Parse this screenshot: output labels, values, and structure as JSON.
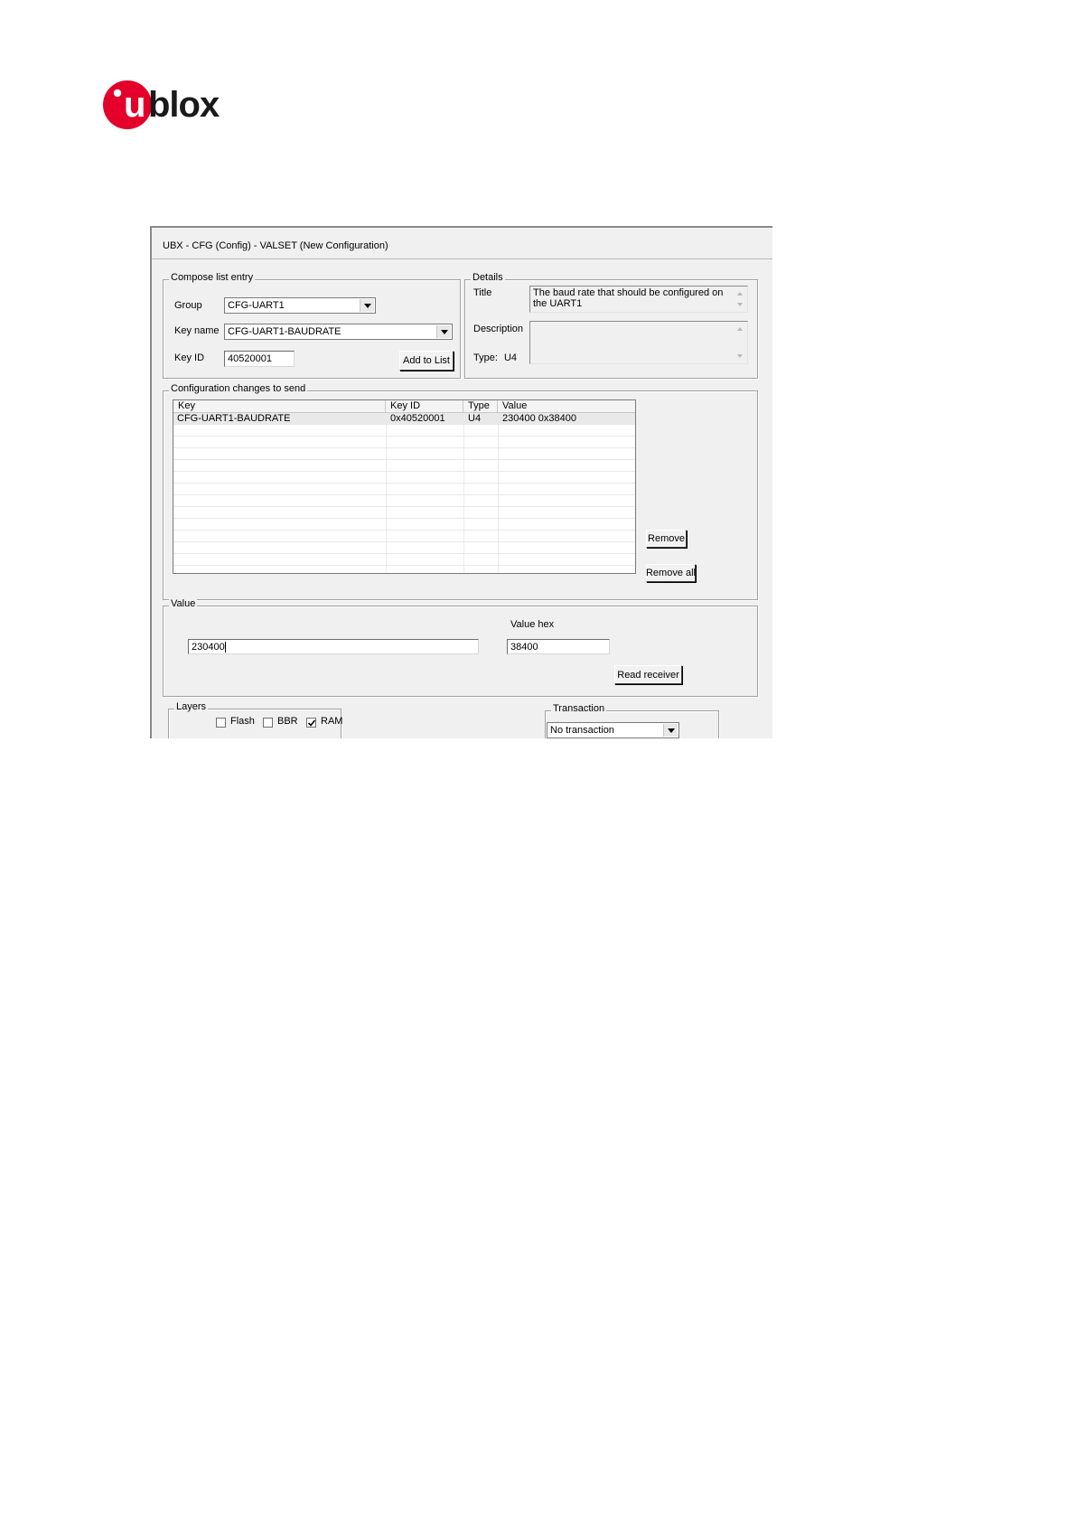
{
  "logo": {
    "text": "ublox",
    "letter_u": "u",
    "rest": "blox",
    "brand_color": "#e4002b"
  },
  "window": {
    "title": "UBX - CFG (Config) - VALSET (New Configuration)"
  },
  "compose": {
    "legend": "Compose list entry",
    "group_label": "Group",
    "group_value": "CFG-UART1",
    "keyname_label": "Key name",
    "keyname_value": "CFG-UART1-BAUDRATE",
    "keyid_label": "Key ID",
    "keyid_value": "40520001",
    "add_button": "Add to List"
  },
  "details": {
    "legend": "Details",
    "title_label": "Title",
    "title_value": "The baud rate that should be configured on the UART1",
    "description_label": "Description",
    "description_value": "",
    "type_label": "Type:",
    "type_value": "U4"
  },
  "changes": {
    "legend": "Configuration changes to send",
    "columns": [
      "Key",
      "Key ID",
      "Type",
      "Value"
    ],
    "rows": [
      {
        "key": "CFG-UART1-BAUDRATE",
        "key_id": "0x40520001",
        "type": "U4",
        "value": "230400  0x38400"
      }
    ],
    "remove_button": "Remove",
    "remove_all_button": "Remove all"
  },
  "value": {
    "legend": "Value",
    "value_field": "230400",
    "hex_label": "Value hex",
    "hex_field": "38400",
    "read_button": "Read receiver"
  },
  "layers": {
    "legend": "Layers",
    "flash_label": "Flash",
    "flash_checked": false,
    "bbr_label": "BBR",
    "bbr_checked": false,
    "ram_label": "RAM",
    "ram_checked": true
  },
  "transaction": {
    "legend": "Transaction",
    "selected": "No transaction"
  }
}
